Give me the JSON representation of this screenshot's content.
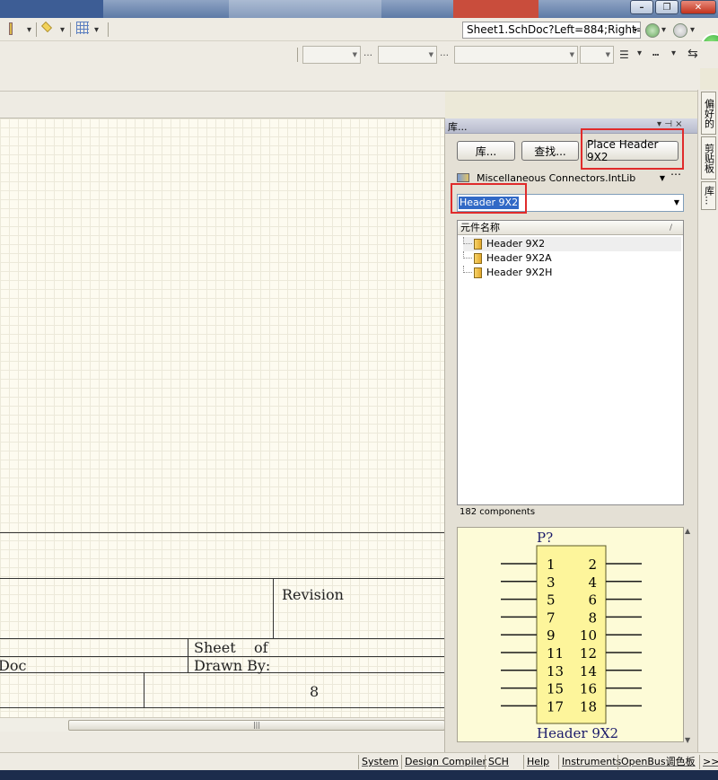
{
  "toolbar": {
    "address": "Sheet1.SchDoc?Left=884;Right="
  },
  "panel": {
    "title": "库...",
    "pin_glyph": "▾ ⊣ ×",
    "buttons": {
      "libraries": "库...",
      "search": "查找...",
      "place": "Place Header 9X2"
    },
    "library_name": "Miscellaneous Connectors.IntLib",
    "filter_value": "Header 9X2",
    "list_header": "元件名称",
    "sort_glyph": "/",
    "items": [
      {
        "label": "Header 9X2",
        "selected": true
      },
      {
        "label": "Header 9X2A",
        "selected": false
      },
      {
        "label": "Header 9X2H",
        "selected": false
      }
    ],
    "count": "182 components"
  },
  "preview": {
    "designator": "P?",
    "comment": "Header 9X2",
    "left_pins": [
      "1",
      "3",
      "5",
      "7",
      "9",
      "11",
      "13",
      "15",
      "17"
    ],
    "right_pins": [
      "2",
      "4",
      "6",
      "8",
      "10",
      "12",
      "14",
      "16",
      "18"
    ],
    "body_color": "#fdf59b",
    "pin_color": "#1a1a1a",
    "text_color": "#1a1a6a"
  },
  "titleblock": {
    "revision": "Revision",
    "sheet_of": "Sheet    of",
    "doc": "Doc",
    "drawn_by": "Drawn By:",
    "number": "8"
  },
  "right_tabs": [
    "偏好的",
    "剪贴板",
    "库..."
  ],
  "status_tabs": [
    "System",
    "Design Compiler",
    "SCH",
    "Help",
    "Instruments",
    "OpenBus调色板",
    ">>"
  ],
  "scroll_grip": "|||"
}
